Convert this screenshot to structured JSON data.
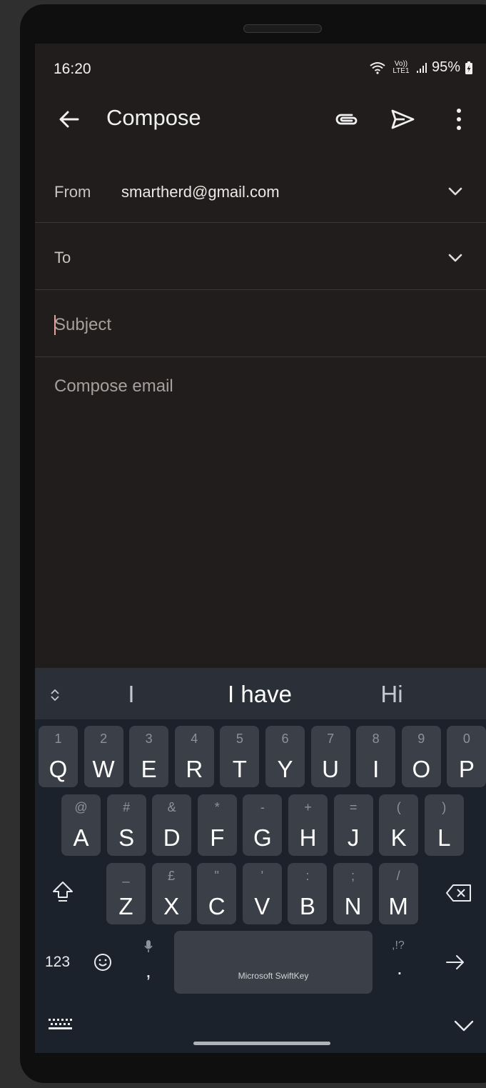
{
  "status_bar": {
    "time": "16:20",
    "network": "Vo)) LTE1",
    "battery": "95%"
  },
  "app_bar": {
    "title": "Compose"
  },
  "from": {
    "label": "From",
    "value": "smartherd@gmail.com"
  },
  "to": {
    "label": "To"
  },
  "subject": {
    "placeholder": "Subject"
  },
  "body": {
    "placeholder": "Compose email"
  },
  "keyboard": {
    "suggestions": [
      "I",
      "I have",
      "Hi"
    ],
    "row1": [
      {
        "main": "Q",
        "sec": "1"
      },
      {
        "main": "W",
        "sec": "2"
      },
      {
        "main": "E",
        "sec": "3"
      },
      {
        "main": "R",
        "sec": "4"
      },
      {
        "main": "T",
        "sec": "5"
      },
      {
        "main": "Y",
        "sec": "6"
      },
      {
        "main": "U",
        "sec": "7"
      },
      {
        "main": "I",
        "sec": "8"
      },
      {
        "main": "O",
        "sec": "9"
      },
      {
        "main": "P",
        "sec": "0"
      }
    ],
    "row2": [
      {
        "main": "A",
        "sec": "@"
      },
      {
        "main": "S",
        "sec": "#"
      },
      {
        "main": "D",
        "sec": "&"
      },
      {
        "main": "F",
        "sec": "*"
      },
      {
        "main": "G",
        "sec": "-"
      },
      {
        "main": "H",
        "sec": "+"
      },
      {
        "main": "J",
        "sec": "="
      },
      {
        "main": "K",
        "sec": "("
      },
      {
        "main": "L",
        "sec": ")"
      }
    ],
    "row3": [
      {
        "main": "Z",
        "sec": "_"
      },
      {
        "main": "X",
        "sec": "£"
      },
      {
        "main": "C",
        "sec": "\""
      },
      {
        "main": "V",
        "sec": "'"
      },
      {
        "main": "B",
        "sec": ":"
      },
      {
        "main": "N",
        "sec": ";"
      },
      {
        "main": "M",
        "sec": "/"
      }
    ],
    "numbers_label": "123",
    "comma": ",",
    "period": ".",
    "period_alt": ",!?",
    "space_brand": "Microsoft SwiftKey"
  },
  "colors": {
    "screen_bg": "#201d1c",
    "keyboard_bg": "#1c222b",
    "key_bg": "#3b4048",
    "cursor": "#e8a098"
  }
}
